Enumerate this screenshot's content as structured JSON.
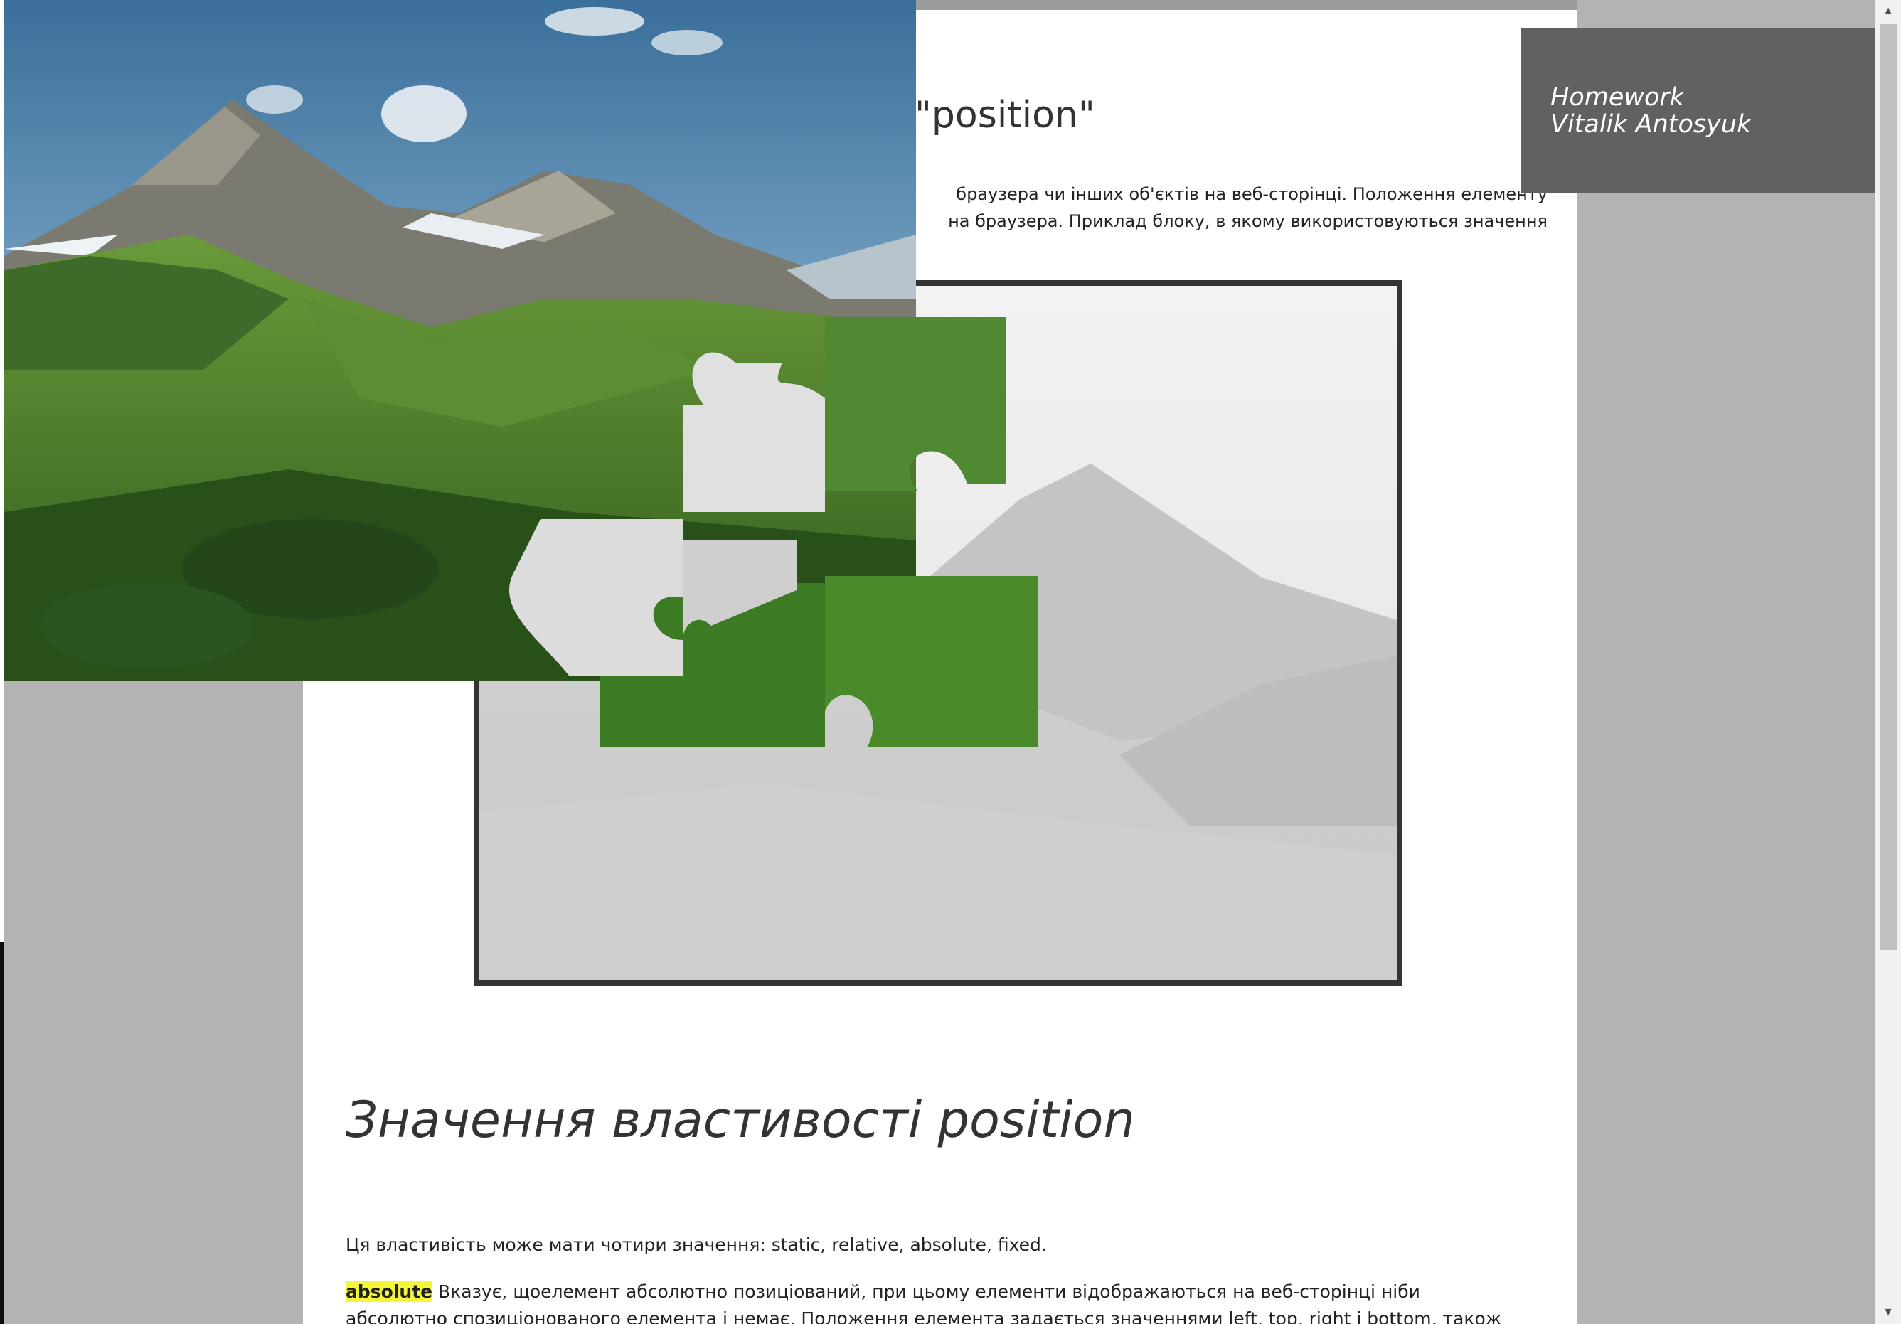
{
  "header": {
    "title_fragment": "\"position\""
  },
  "intro": {
    "line1": "браузера чи інших об'єктів на веб-сторінці. Положення елементу",
    "line2": "на браузера. Приклад блоку, в якому використовуються значення"
  },
  "section": {
    "heading": "Значення властивості position",
    "values_text": "Ця властивість може мати чотири значення: static, relative, absolute, fixed.",
    "absolute_label": "absolute",
    "absolute_text": " Вказує, щоелемент абсолютно позиціований, при цьому елементи відображаються на веб-сторінці ніби абсолютно спозиціонованого елемента і немає. Положення елемента задається значеннями left, top, right і bottom, також на положення"
  },
  "badge": {
    "line1": "Homework",
    "line2": "Vitalik Antosyuk"
  },
  "scrollbar": {
    "up_icon": "▲",
    "down_icon": "▼"
  },
  "colors": {
    "page_bg": "#b3b3b3",
    "content_bg": "#ffffff",
    "badge_bg": "#616161",
    "highlight": "#f5f53a",
    "frame_border": "#333333"
  },
  "icons": [
    "scroll-up-arrow-icon",
    "scroll-down-arrow-icon"
  ]
}
